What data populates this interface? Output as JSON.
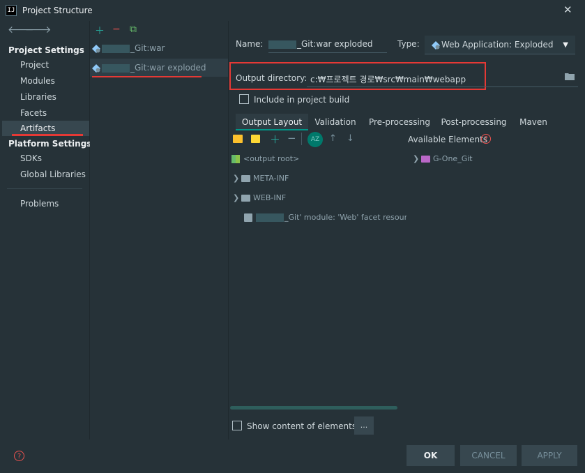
{
  "window": {
    "title": "Project Structure",
    "app_icon_text": "IJ"
  },
  "nav": {
    "project_settings_header": "Project Settings",
    "project_settings_items": [
      "Project",
      "Modules",
      "Libraries",
      "Facets",
      "Artifacts"
    ],
    "platform_settings_header": "Platform Settings",
    "platform_settings_items": [
      "SDKs",
      "Global Libraries"
    ],
    "problems": "Problems"
  },
  "artifacts": {
    "items": [
      {
        "suffix": "_Git:war"
      },
      {
        "suffix": "_Git:war exploded"
      }
    ]
  },
  "detail": {
    "name_label": "Name:",
    "name_value_suffix": "_Git:war exploded",
    "type_label": "Type:",
    "type_value": "Web Application: Exploded",
    "output_dir_label": "Output directory:",
    "output_dir_value": "c:₩프로젝트 경로₩src₩main₩webapp",
    "include_build_label": "Include in project build",
    "include_build_checked": false
  },
  "tabs": [
    "Output Layout",
    "Validation",
    "Pre-processing",
    "Post-processing",
    "Maven"
  ],
  "selected_tab": "Output Layout",
  "layout_tree": {
    "root": "<output root>",
    "folders": [
      "META-INF",
      "WEB-INF"
    ],
    "module_suffix": "_Git' module: 'Web' facet resourc"
  },
  "available": {
    "header": "Available Elements",
    "items": [
      "G-One_Git"
    ]
  },
  "show_content_label": "Show content of elements",
  "show_content_checked": false,
  "more_button": "...",
  "buttons": {
    "ok": "OK",
    "cancel": "CANCEL",
    "apply": "APPLY"
  },
  "colors": {
    "accent": "#009688",
    "highlight_red": "#e53935",
    "background": "#263238"
  }
}
